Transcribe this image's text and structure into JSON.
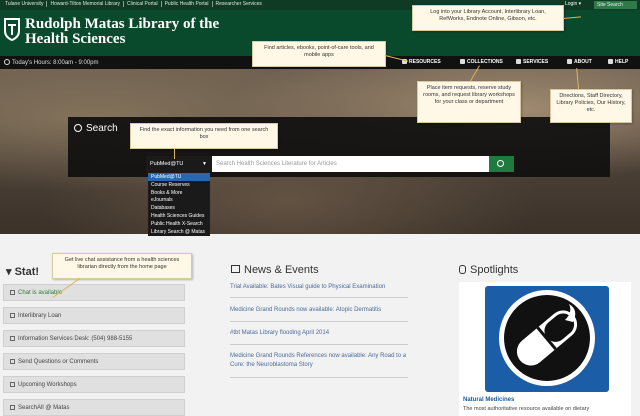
{
  "utility": {
    "links": [
      "Tulane University",
      "Howard-Tilton Memorial Library",
      "Clinical Portal",
      "Public Health Portal",
      "Researcher Services"
    ],
    "login": "Login ▾",
    "site_search": "Site Search"
  },
  "header": {
    "title": "Rudolph Matas Library of the Health Sciences"
  },
  "nav": {
    "hours": "Today's Hours: 8:00am - 9:00pm",
    "items": [
      "RESOURCES",
      "COLLECTIONS",
      "SERVICES",
      "ABOUT",
      "HELP"
    ]
  },
  "search": {
    "title": "Search",
    "selected": "PubMed@TU",
    "placeholder": "Search Health Sciences Literature for Articles",
    "options": [
      "PubMed@TU",
      "Course Reserves",
      "Books & More",
      "eJournals",
      "Databases",
      "Health Sciences Guides",
      "Public Health X-Search",
      "Library Search @ Matas"
    ]
  },
  "stat": {
    "heading": "Stat!",
    "items": [
      "Chat is available",
      "Interlibrary Loan",
      "Information Services Desk: (504) 988-5155",
      "Send Questions or Comments",
      "Upcoming Workshops",
      "SearchAll @ Matas"
    ]
  },
  "news": {
    "heading": "News & Events",
    "items": [
      "Trial Available: Bates Visual guide to Physical Examination",
      "Medicine Grand Rounds now available: Atopic Dermatitis",
      "#tbt Matas Library flooding April 2014",
      "Medicine Grand Rounds References now available: Any Road to a Cure: the Neuroblastoma Story"
    ]
  },
  "spotlight": {
    "heading": "Spotlights",
    "title": "Natural Medicines",
    "desc": "The most authoritative resource available on dietary"
  },
  "callouts": [
    "Log into your Library Account, Interlibrary Loan, RefWorks, Endnote Online, Gibson, etc.",
    "Find articles, ebooks, point-of-care tools, and mobile apps",
    "Place item requests, reserve study rooms, and request library workshops for your class or department",
    "Directions, Staff Directory, Library Policies, Our History, etc.",
    "Find the exact information you need from one search box",
    "Get live chat assistance from a health sciences librarian directly from the home page"
  ],
  "colors": {
    "brand_green": "#0a4a2c",
    "nav_bg": "#111111",
    "accent_green": "#1f7a3f",
    "link": "#4a6a9a"
  }
}
